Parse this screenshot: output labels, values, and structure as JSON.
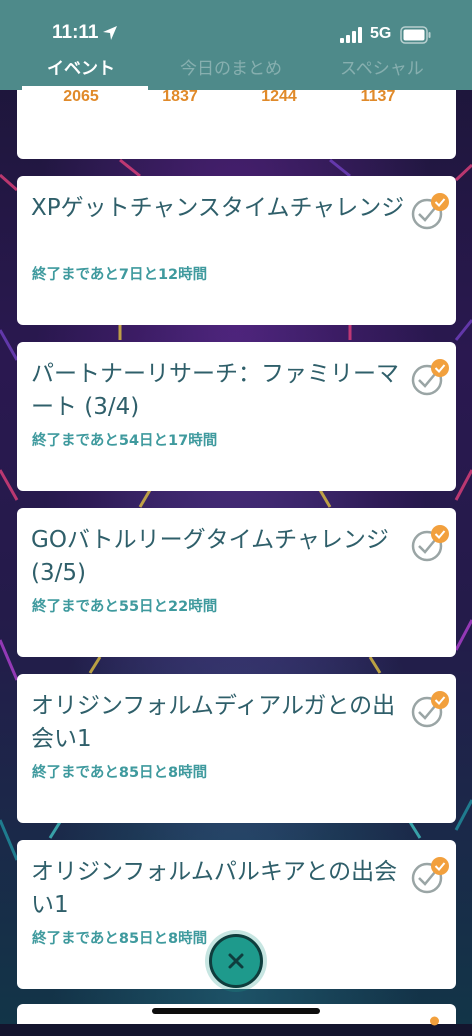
{
  "status_bar": {
    "time": "11:11",
    "network": "5G"
  },
  "tabs": [
    {
      "label": "イベント",
      "active": true
    },
    {
      "label": "今日のまとめ",
      "active": false
    },
    {
      "label": "スペシャル",
      "active": false
    }
  ],
  "stats": [
    "2065",
    "1837",
    "1244",
    "1137"
  ],
  "events": [
    {
      "title": "XPゲットチャンスタイムチャレンジ",
      "remaining": "終了まであと7日と12時間"
    },
    {
      "title": "パートナーリサーチ：ファミリーマート (3/4)",
      "remaining": "終了まであと54日と17時間"
    },
    {
      "title": "GOバトルリーグタイムチャレンジ (3/5)",
      "remaining": "終了まであと55日と22時間"
    },
    {
      "title": "オリジンフォルムディアルガとの出会い1",
      "remaining": "終了まであと85日と8時間"
    },
    {
      "title": "オリジンフォルムパルキアとの出会い1",
      "remaining": "終了まであと85日と8時間"
    }
  ],
  "colors": {
    "header": "#4e8a8a",
    "title": "#2f5f6a",
    "remaining": "#3f9a9e",
    "stat": "#e08a2a",
    "check_badge": "#f2a03d",
    "fab": "#1e9a8c"
  },
  "icons": {
    "status": [
      "location-arrow-icon",
      "cellular-signal-icon",
      "battery-icon"
    ],
    "card": "check-complete-icon",
    "fab": "close-icon"
  }
}
